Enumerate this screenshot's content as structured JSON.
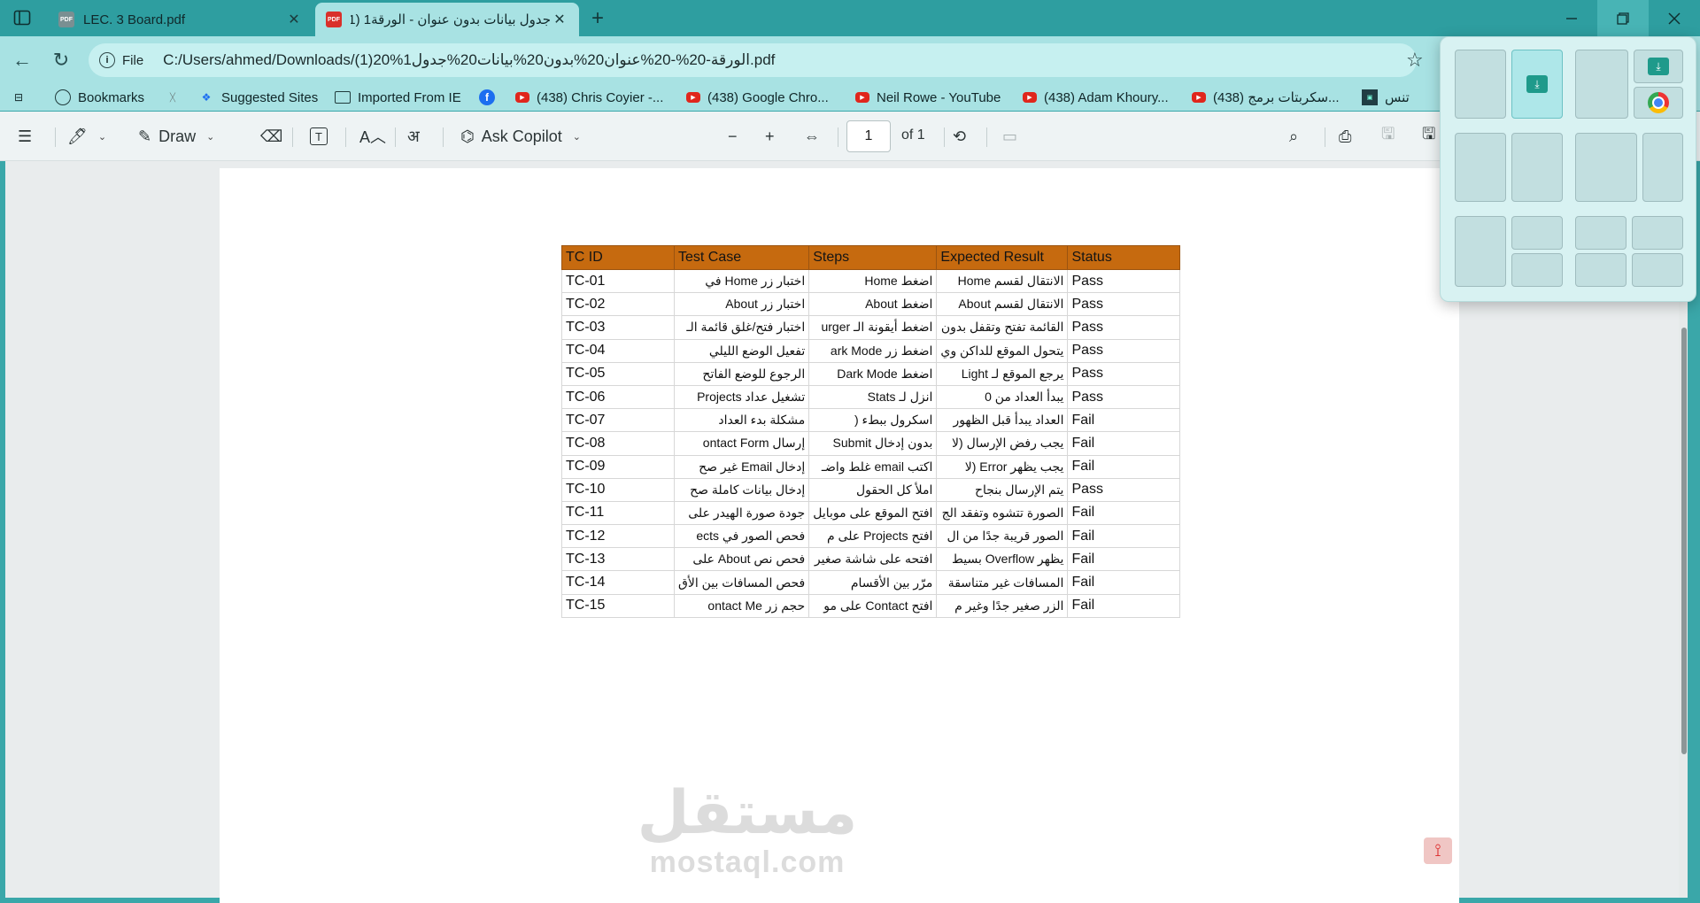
{
  "tabs": [
    {
      "title": "LEC. 3 Board.pdf",
      "active": false
    },
    {
      "title": "جدول بيانات بدون عنوان - الورقة1 (1)",
      "active": true
    }
  ],
  "address": {
    "scheme_label": "File",
    "url": "C:/Users/ahmed/Downloads/(1)20%1الورقة-20%-20%عنوان20%بدون20%بيانات20%جدول.pdf"
  },
  "bookmarks": [
    {
      "label": "Bookmarks",
      "icon": "bookmarks-icon"
    },
    {
      "label": "",
      "icon": "site-icon"
    },
    {
      "label": "Suggested Sites",
      "icon": "suggested-sites-icon"
    },
    {
      "label": "Imported From IE",
      "icon": "folder-icon"
    },
    {
      "label": "",
      "icon": "facebook-icon"
    },
    {
      "label": "(438) Chris Coyier -...",
      "icon": "youtube-icon"
    },
    {
      "label": "(438) Google Chro...",
      "icon": "youtube-icon"
    },
    {
      "label": "Neil Rowe - YouTube",
      "icon": "youtube-icon"
    },
    {
      "label": "(438) Adam Khoury...",
      "icon": "youtube-icon"
    },
    {
      "label": "(438) سكربتات برمج...",
      "icon": "youtube-icon"
    },
    {
      "label": "تنس",
      "icon": "site-icon"
    }
  ],
  "pdf_toolbar": {
    "draw_label": "Draw",
    "copilot_label": "Ask Copilot",
    "page_number": "1",
    "page_total": "of 1"
  },
  "table": {
    "headers": [
      "TC ID",
      "Test Case",
      "Steps",
      "Expected Result",
      "Status"
    ],
    "rows": [
      [
        "TC-01",
        "اختبار زر Home في",
        "اضغط Home",
        "الانتقال لقسم Home",
        "Pass"
      ],
      [
        "TC-02",
        "اختبار زر About",
        "اضغط About",
        "الانتقال لقسم About",
        "Pass"
      ],
      [
        "TC-03",
        "اختبار فتح/غلق قائمة الـ",
        "اضغط أيقونة الـ urger",
        "القائمة تفتح وتقفل بدون",
        "Pass"
      ],
      [
        "TC-04",
        "تفعيل الوضع الليلي",
        "اضغط زر ark Mode",
        "يتحول الموقع للداكن وي",
        "Pass"
      ],
      [
        "TC-05",
        "الرجوع للوضع الفاتح",
        "اضغط Dark Mode",
        "يرجع الموقع لـ Light",
        "Pass"
      ],
      [
        "TC-06",
        "تشغيل عداد Projects",
        "انزل لـ Stats",
        "يبدأ العداد من 0",
        "Pass"
      ],
      [
        "TC-07",
        "مشكلة بدء العداد",
        "اسكرول ببطء (",
        "العداد يبدأ قبل الظهور",
        "Fail"
      ],
      [
        "TC-08",
        "إرسال ontact Form",
        "بدون إدخال Submit",
        "يجب رفض الإرسال (لا",
        "Fail"
      ],
      [
        "TC-09",
        "إدخال Email غير صح",
        "اكتب email غلط واضـ",
        "يجب يظهر Error (لا",
        "Fail"
      ],
      [
        "TC-10",
        "إدخال بيانات كاملة صح",
        "املأ كل الحقول",
        "يتم الإرسال بنجاح",
        "Pass"
      ],
      [
        "TC-11",
        "جودة صورة الهيدر على",
        "افتح الموقع على موبايل",
        "الصورة تتشوه وتفقد الج",
        "Fail"
      ],
      [
        "TC-12",
        "فحص الصور في ects",
        "افتح Projects على م",
        "الصور قريبة جدًا من ال",
        "Fail"
      ],
      [
        "TC-13",
        "فحص نص About على",
        "افتحه على شاشة صغير",
        "يظهر Overflow بسيط",
        "Fail"
      ],
      [
        "TC-14",
        "فحص المسافات بين الأق",
        "مرّر بين الأقسام",
        "المسافات غير متناسقة",
        "Fail"
      ],
      [
        "TC-15",
        "حجم زر ontact Me",
        "افتح Contact على مو",
        "الزر صغير جدًا وغير م",
        "Fail"
      ]
    ]
  },
  "watermark": {
    "arabic": "مستقل",
    "latin": "mostaql.com"
  },
  "colors": {
    "frame": "#3aa7a9",
    "toolbar": "#a8e2e3",
    "table_header": "#c66a0f"
  }
}
